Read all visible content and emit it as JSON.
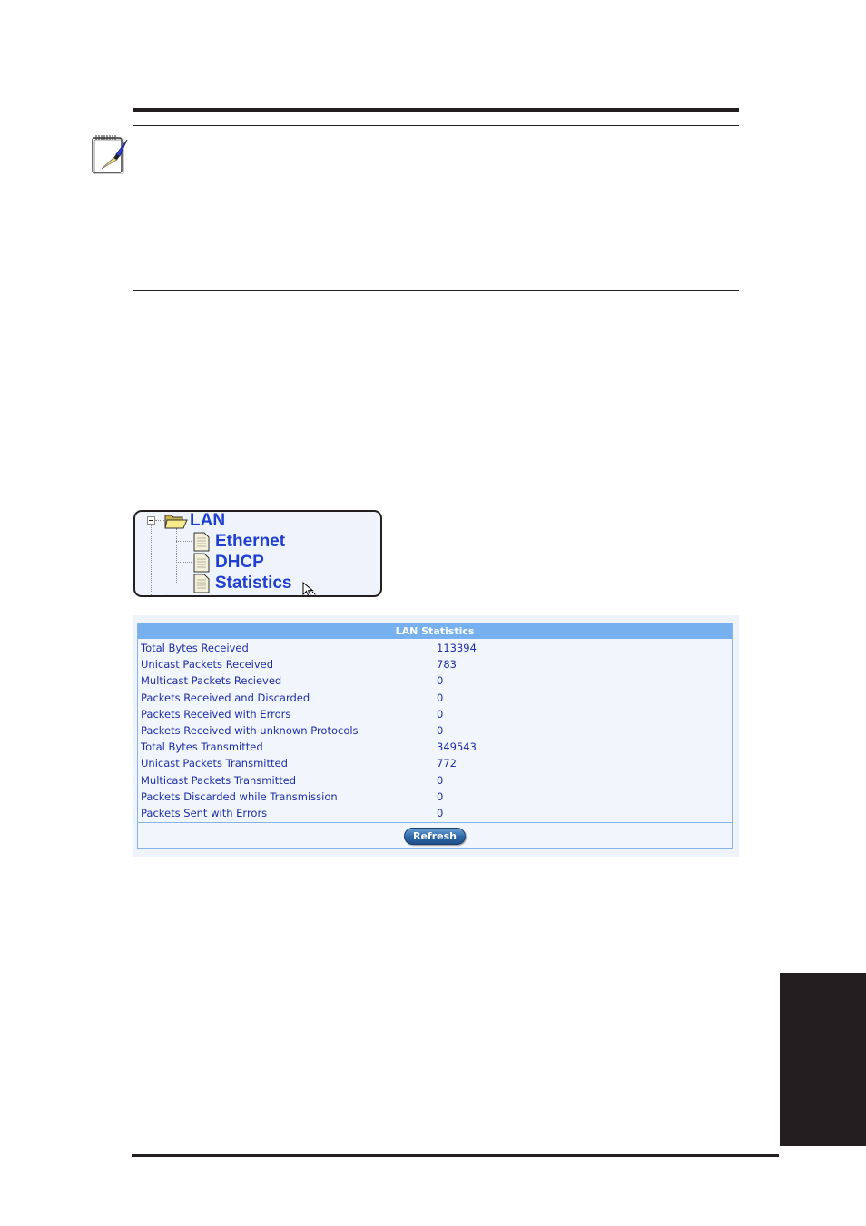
{
  "tree": {
    "root": {
      "label": "LAN",
      "icon": "folder-open-icon",
      "expanded": true
    },
    "children": [
      {
        "label": "Ethernet",
        "icon": "document-icon"
      },
      {
        "label": "DHCP",
        "icon": "document-icon"
      },
      {
        "label": "Statistics",
        "icon": "document-icon"
      }
    ]
  },
  "stats": {
    "title": "LAN Statistics",
    "rows": [
      {
        "label": "Total Bytes Received",
        "value": "113394"
      },
      {
        "label": "Unicast Packets Received",
        "value": "783"
      },
      {
        "label": "Multicast Packets Recieved",
        "value": "0"
      },
      {
        "label": "Packets Received and Discarded",
        "value": "0"
      },
      {
        "label": "Packets Received with Errors",
        "value": "0"
      },
      {
        "label": "Packets Received with unknown Protocols",
        "value": "0"
      },
      {
        "label": "Total Bytes Transmitted",
        "value": "349543"
      },
      {
        "label": "Unicast Packets Transmitted",
        "value": "772"
      },
      {
        "label": "Multicast Packets Transmitted",
        "value": "0"
      },
      {
        "label": "Packets Discarded while Transmission",
        "value": "0"
      },
      {
        "label": "Packets Sent with Errors",
        "value": "0"
      }
    ],
    "refresh_label": "Refresh"
  },
  "colors": {
    "header_bg": "#77b0ee",
    "text_blue": "#1f2fa6",
    "tree_link": "#1e3fd0",
    "rule": "#231f20"
  }
}
